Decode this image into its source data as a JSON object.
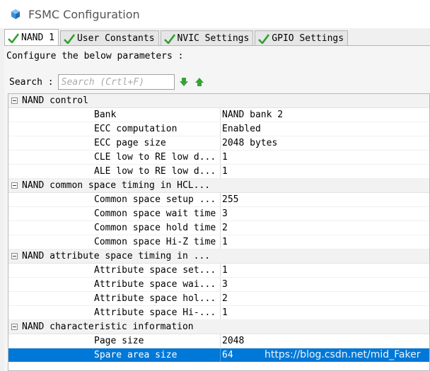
{
  "window": {
    "title": "FSMC Configuration",
    "icon": "cube-icon"
  },
  "tabs": [
    {
      "label": "NAND 1",
      "icon": "check-icon",
      "active": true
    },
    {
      "label": "User Constants",
      "icon": "check-icon"
    },
    {
      "label": "NVIC Settings",
      "icon": "check-icon"
    },
    {
      "label": "GPIO Settings",
      "icon": "check-icon"
    }
  ],
  "panel": {
    "instruction": "Configure the below parameters :",
    "search": {
      "label": "Search :",
      "placeholder": "Search (Crtl+F)"
    }
  },
  "groups": [
    {
      "title": "NAND control",
      "params": [
        {
          "name": "Bank",
          "value": "NAND bank 2"
        },
        {
          "name": "ECC computation",
          "value": "Enabled"
        },
        {
          "name": "ECC page size",
          "value": "2048 bytes"
        },
        {
          "name": "CLE low to RE low d...",
          "value": "1"
        },
        {
          "name": "ALE low to RE low d...",
          "value": "1"
        }
      ]
    },
    {
      "title": "NAND common space timing in HCL...",
      "params": [
        {
          "name": "Common space setup ...",
          "value": "255"
        },
        {
          "name": "Common space wait time",
          "value": "3"
        },
        {
          "name": "Common space hold time",
          "value": "2"
        },
        {
          "name": "Common space Hi-Z time",
          "value": "1"
        }
      ]
    },
    {
      "title": "NAND attribute space timing in ...",
      "params": [
        {
          "name": "Attribute space set...",
          "value": "1"
        },
        {
          "name": "Attribute space wai...",
          "value": "3"
        },
        {
          "name": "Attribute space hol...",
          "value": "2"
        },
        {
          "name": "Attribute space Hi-...",
          "value": "1"
        }
      ]
    },
    {
      "title": "NAND characteristic information",
      "params": [
        {
          "name": "Page size",
          "value": "2048"
        },
        {
          "name": "Spare area size",
          "value": "64",
          "selected": true
        }
      ]
    }
  ],
  "watermark": "https://blog.csdn.net/mid_Faker",
  "colors": {
    "selection": "#0078d7",
    "check": "#2ea12e",
    "arrow": "#33a532"
  }
}
